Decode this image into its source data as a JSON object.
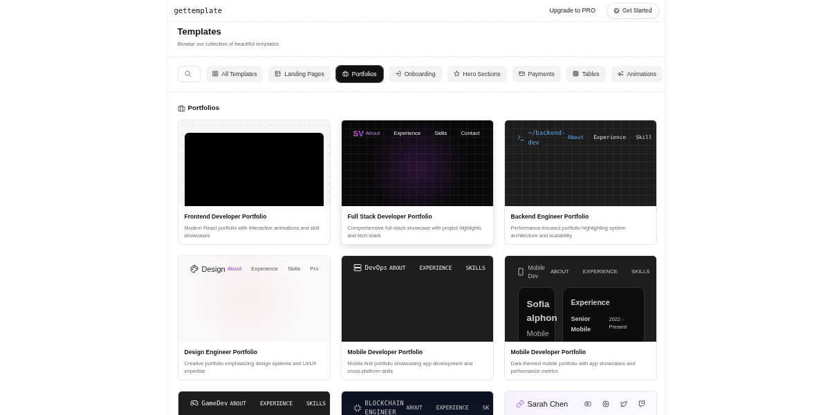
{
  "header": {
    "logo": "gettemplate",
    "links": [
      {
        "label": "Upgrade to PRO",
        "kind": "link"
      },
      {
        "label": "Get Started",
        "kind": "button"
      }
    ]
  },
  "page": {
    "title": "Templates",
    "subtitle": "Browse our collection of beautiful templates"
  },
  "filters": [
    {
      "label": "All Templates",
      "selected": false
    },
    {
      "label": "Landing Pages",
      "selected": false
    },
    {
      "label": "Portfolios",
      "selected": true
    },
    {
      "label": "Onboarding",
      "selected": false
    },
    {
      "label": "Hero Sections",
      "selected": false
    },
    {
      "label": "Payments",
      "selected": false
    },
    {
      "label": "Tables",
      "selected": false
    },
    {
      "label": "Animations",
      "selected": false
    }
  ],
  "section": {
    "title": "Portfolios"
  },
  "cards": [
    {
      "title": "Frontend Developer Portfolio",
      "description": "Modern React portfolio with interactive animations and skill showcases",
      "hovered": false,
      "preview": {
        "kind": "mockup"
      }
    },
    {
      "title": "Full Stack Developer Portfolio",
      "description": "Comprehensive full-stack showcase with project highlights and tech stack",
      "hovered": true,
      "preview": {
        "kind": "glow",
        "brand": "SV",
        "nav": [
          {
            "label": "About",
            "selected": true
          },
          {
            "label": "Experience",
            "selected": false
          },
          {
            "label": "Skills",
            "selected": false
          },
          {
            "label": "Contact",
            "selected": false
          }
        ]
      }
    },
    {
      "title": "Backend Engineer Portfolio",
      "description": "Performance-focused portfolio highlighting system architecture and scalability",
      "hovered": false,
      "preview": {
        "kind": "terminal",
        "brand": "~/backend-dev",
        "nav": [
          {
            "label": "About",
            "selected": true
          },
          {
            "label": "Experience",
            "selected": false
          },
          {
            "label": "Skill",
            "selected": false
          }
        ]
      }
    },
    {
      "title": "Design Engineer Portfolio",
      "description": "Creative portfolio emphasizing design systems and UI/UX expertise",
      "hovered": false,
      "preview": {
        "kind": "light",
        "brand": "Design",
        "nav": [
          {
            "label": "About",
            "selected": true
          },
          {
            "label": "Experience",
            "selected": false
          },
          {
            "label": "Skills",
            "selected": false
          },
          {
            "label": "Pro",
            "selected": false
          }
        ]
      }
    },
    {
      "title": "Mobile Developer Portfolio",
      "description": "Mobile-first portfolio showcasing app development and cross-platform skills",
      "hovered": false,
      "preview": {
        "kind": "server",
        "brand": "DevOps",
        "nav": [
          {
            "label": "ABOUT",
            "selected": false
          },
          {
            "label": "EXPERIENCE",
            "selected": false
          },
          {
            "label": "SKILLS",
            "selected": false
          }
        ]
      }
    },
    {
      "title": "Mobile Developer Portfolio",
      "description": "Dark-themed mobile portfolio with app showcases and performance metrics",
      "hovered": false,
      "preview": {
        "kind": "mobile",
        "brand": "Mobile Dev",
        "nav": [
          {
            "label": "ABOUT",
            "selected": false
          },
          {
            "label": "EXPERIENCE",
            "selected": false
          },
          {
            "label": "SKILLS",
            "selected": false
          }
        ],
        "profile": {
          "name": "Sofia alphon",
          "role": "Mobile"
        },
        "experience": {
          "heading": "Experience",
          "job": "Senior Mobile",
          "dates": "2022 - Present"
        }
      }
    },
    {
      "hovered": false,
      "preview": {
        "kind": "game",
        "brand": "GameDev",
        "nav": [
          {
            "label": "ABOUT",
            "selected": false
          },
          {
            "label": "EXPERIENCE",
            "selected": false
          },
          {
            "label": "SKILLS",
            "selected": false
          }
        ]
      }
    },
    {
      "hovered": false,
      "preview": {
        "kind": "chain",
        "brand": "BLOCKCHAIN ENGINEER",
        "nav": [
          {
            "label": "ABOUT",
            "selected": false
          },
          {
            "label": "EXPERIENCE",
            "selected": false
          },
          {
            "label": "SK",
            "selected": false
          }
        ]
      }
    },
    {
      "hovered": false,
      "preview": {
        "kind": "social",
        "brand": "Sarah Chen"
      }
    }
  ]
}
